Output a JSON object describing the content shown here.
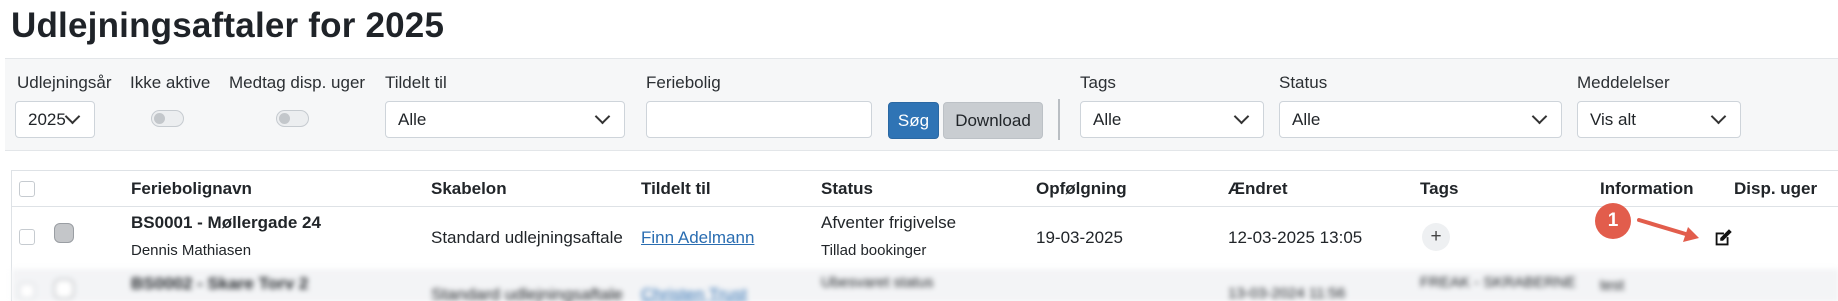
{
  "page": {
    "title": "Udlejningsaftaler for 2025"
  },
  "filters": {
    "year": {
      "label": "Udlejningsår",
      "value": "2025"
    },
    "inactive": {
      "label": "Ikke aktive"
    },
    "disp_weeks": {
      "label": "Medtag disp. uger"
    },
    "assigned": {
      "label": "Tildelt til",
      "value": "Alle"
    },
    "property": {
      "label": "Feriebolig",
      "value": ""
    },
    "search_button": "Søg",
    "download_button": "Download",
    "tags": {
      "label": "Tags",
      "value": "Alle"
    },
    "status": {
      "label": "Status",
      "value": "Alle"
    },
    "messages": {
      "label": "Meddelelser",
      "value": "Vis alt"
    }
  },
  "table": {
    "columns": [
      "Feriebolignavn",
      "Skabelon",
      "Tildelt til",
      "Status",
      "Opfølgning",
      "Ændret",
      "Tags",
      "Information",
      "Disp. uger"
    ],
    "rows": [
      {
        "name": "BS0001 - Møllergade 24",
        "owner": "Dennis Mathiasen",
        "template": "Standard udlejningsaftale",
        "assigned": "Finn Adelmann",
        "status": "Afventer frigivelse",
        "status_sub": "Tillad bookinger",
        "followup": "19-03-2025",
        "changed": "12-03-2025 13:05",
        "tags_add": "+"
      },
      {
        "name": "BS0002 - Skare Torv 2",
        "template": "Standard udlejningsaftale",
        "assigned": "Christen Trust",
        "status": "Ubesvaret status",
        "changed": "13-03-2024 11:56",
        "tags": "FREAK - SKRABERNE",
        "info": "test"
      }
    ]
  },
  "annotation": {
    "badge": "1",
    "color": "#e25d4c"
  },
  "colors": {
    "primary": "#2f74b5",
    "link": "#2a6db1",
    "badge": "#e25d4c"
  }
}
